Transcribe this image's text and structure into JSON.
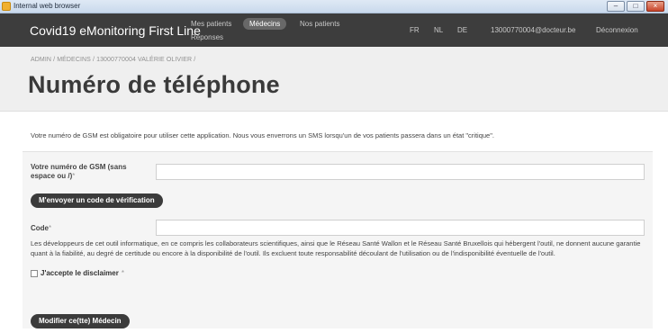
{
  "window": {
    "title": "Internal web browser",
    "minimize": "–",
    "maximize": "□",
    "close": "×"
  },
  "navbar": {
    "brand": "Covid19 eMonitoring First Line",
    "items": [
      {
        "label": "Mes patients",
        "active": false
      },
      {
        "label": "Médecins",
        "active": true
      },
      {
        "label": "Nos patients",
        "active": false
      },
      {
        "label": "Réponses",
        "active": false
      }
    ],
    "languages": [
      "FR",
      "NL",
      "DE"
    ],
    "user_email": "13000770004@docteur.be",
    "logout": "Déconnexion"
  },
  "breadcrumb": "ADMIN / MÉDECINS / 13000770004 VALÉRIE OLIVIER /",
  "page_title": "Numéro de téléphone",
  "intro": "Votre numéro de GSM est obligatoire pour utiliser cette application. Nous vous enverrons un SMS lorsqu'un de vos patients passera dans un état \"critique\".",
  "form": {
    "gsm_label": "Votre numéro de GSM (sans espace ou /)",
    "gsm_value": "",
    "required_mark": "*",
    "send_code_button": "M'envoyer un code de vérification",
    "code_label": "Code",
    "code_value": "",
    "disclaimer": "Les développeurs de cet outil informatique, en ce compris les collaborateurs scientifiques, ainsi que le Réseau Santé Wallon et le Réseau Santé Bruxellois qui hébergent l'outil, ne donnent aucune garantie quant à la fiabilité, au degré de certitude ou encore à la disponibilité de l'outil. Ils excluent toute responsabilité découlant de l'utilisation ou de l'indisponibilité éventuelle de l'outil.",
    "accept_label": "J'accepte le disclaimer",
    "accept_checked": false,
    "submit_button": "Modifier ce(tte) Médecin"
  }
}
